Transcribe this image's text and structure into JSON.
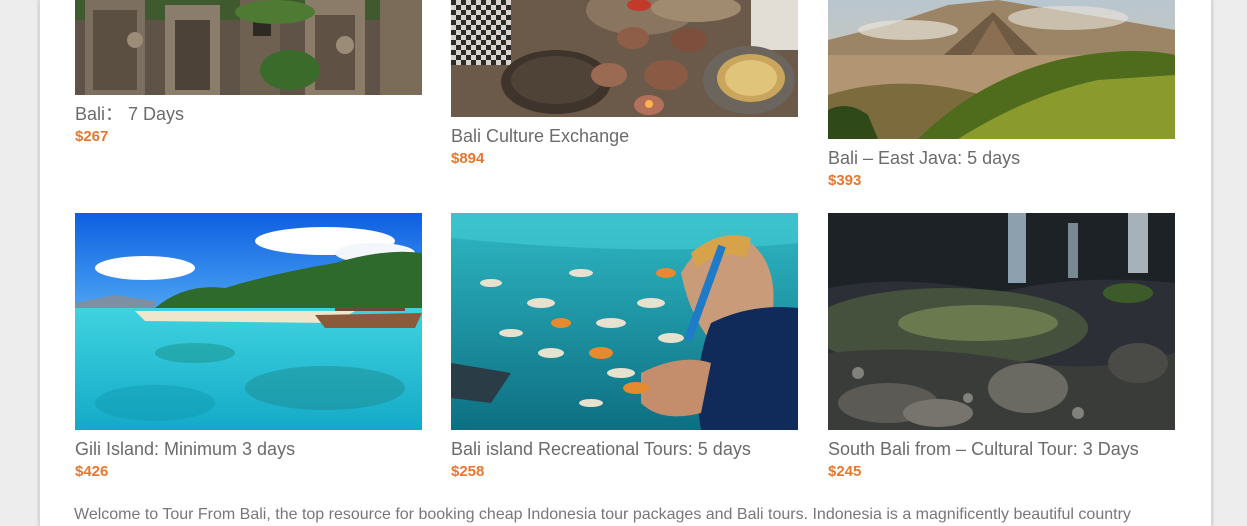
{
  "tours": [
    {
      "title": "Bali：  7 Days",
      "price": "$267",
      "image": "temple-carvings"
    },
    {
      "title": "Bali Culture Exchange",
      "price": "$894",
      "image": "cooking-class"
    },
    {
      "title": "Bali – East Java: 5 days",
      "price": "$393",
      "image": "bromo-volcano"
    },
    {
      "title": "Gili Island: Minimum 3 days",
      "price": "$426",
      "image": "tropical-beach"
    },
    {
      "title": "Bali island Recreational Tours: 5 days",
      "price": "$258",
      "image": "snorkeling-fish"
    },
    {
      "title": "South Bali from – Cultural Tour: 3 Days",
      "price": "$245",
      "image": "waterfall-rocks"
    }
  ],
  "intro_text": "Welcome to Tour From Bali, the top resource for booking cheap Indonesia tour packages and Bali tours. Indonesia is a magnificently beautiful country",
  "colors": {
    "price": "#e8772e",
    "title": "#6b6b6b",
    "background": "#ededed",
    "panel": "#ffffff"
  }
}
